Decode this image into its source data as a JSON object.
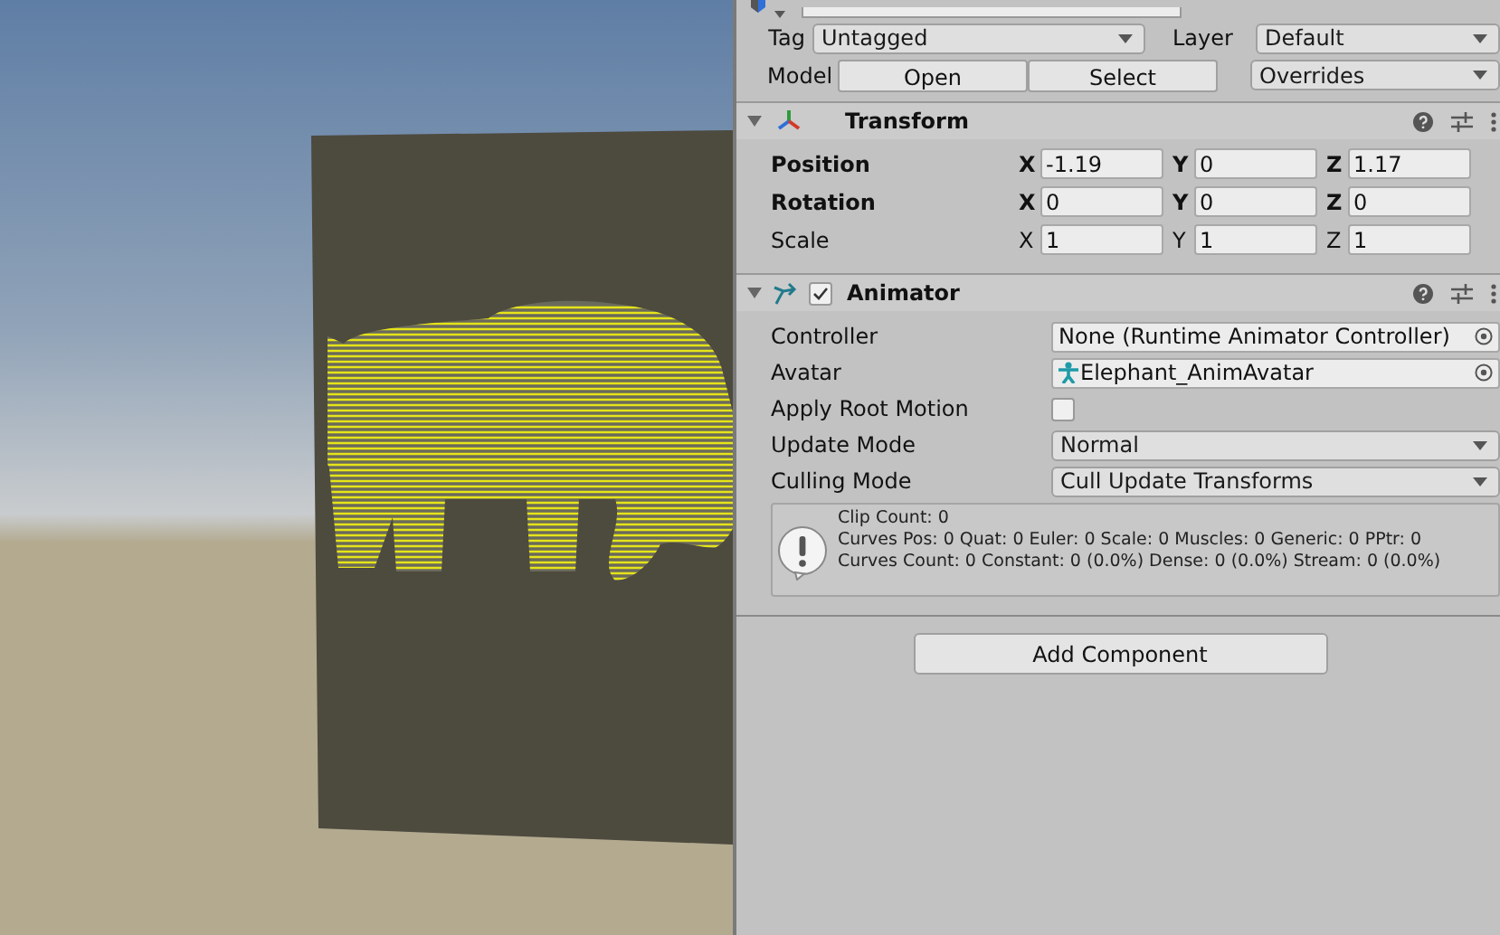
{
  "inspector": {
    "tag": {
      "label": "Tag",
      "value": "Untagged"
    },
    "layer": {
      "label": "Layer",
      "value": "Default"
    },
    "model": {
      "label": "Model",
      "buttons": [
        "Open",
        "Select"
      ],
      "dropdown": "Overrides"
    },
    "components": [
      {
        "kind": "transform",
        "title": "Transform",
        "expanded": true,
        "rows": [
          {
            "label": "Position",
            "bold": true,
            "fields": [
              {
                "axis": "X",
                "value": "-1.19"
              },
              {
                "axis": "Y",
                "value": "0"
              },
              {
                "axis": "Z",
                "value": "1.17"
              }
            ]
          },
          {
            "label": "Rotation",
            "bold": true,
            "fields": [
              {
                "axis": "X",
                "value": "0"
              },
              {
                "axis": "Y",
                "value": "0"
              },
              {
                "axis": "Z",
                "value": "0"
              }
            ]
          },
          {
            "label": "Scale",
            "bold": false,
            "fields": [
              {
                "axis": "X",
                "value": "1"
              },
              {
                "axis": "Y",
                "value": "1"
              },
              {
                "axis": "Z",
                "value": "1"
              }
            ]
          }
        ]
      },
      {
        "kind": "animator",
        "title": "Animator",
        "expanded": true,
        "enabled": true,
        "props": [
          {
            "kind": "object",
            "label": "Controller",
            "value": "None (Runtime Animator Controller)",
            "has_icon": false
          },
          {
            "kind": "object",
            "label": "Avatar",
            "value": "Elephant_AnimAvatar",
            "has_icon": true
          },
          {
            "kind": "checkbox",
            "label": "Apply Root Motion",
            "checked": false
          },
          {
            "kind": "dropdown",
            "label": "Update Mode",
            "value": "Normal"
          },
          {
            "kind": "dropdown",
            "label": "Culling Mode",
            "value": "Cull Update Transforms"
          }
        ],
        "info": [
          "Clip Count: 0",
          "Curves Pos: 0 Quat: 0 Euler: 0 Scale: 0 Muscles: 0 Generic: 0 PPtr: 0",
          "Curves Count: 0 Constant: 0 (0.0%) Dense: 0 (0.0%) Stream: 0 (0.0%)"
        ]
      }
    ],
    "add_component": "Add Component"
  }
}
